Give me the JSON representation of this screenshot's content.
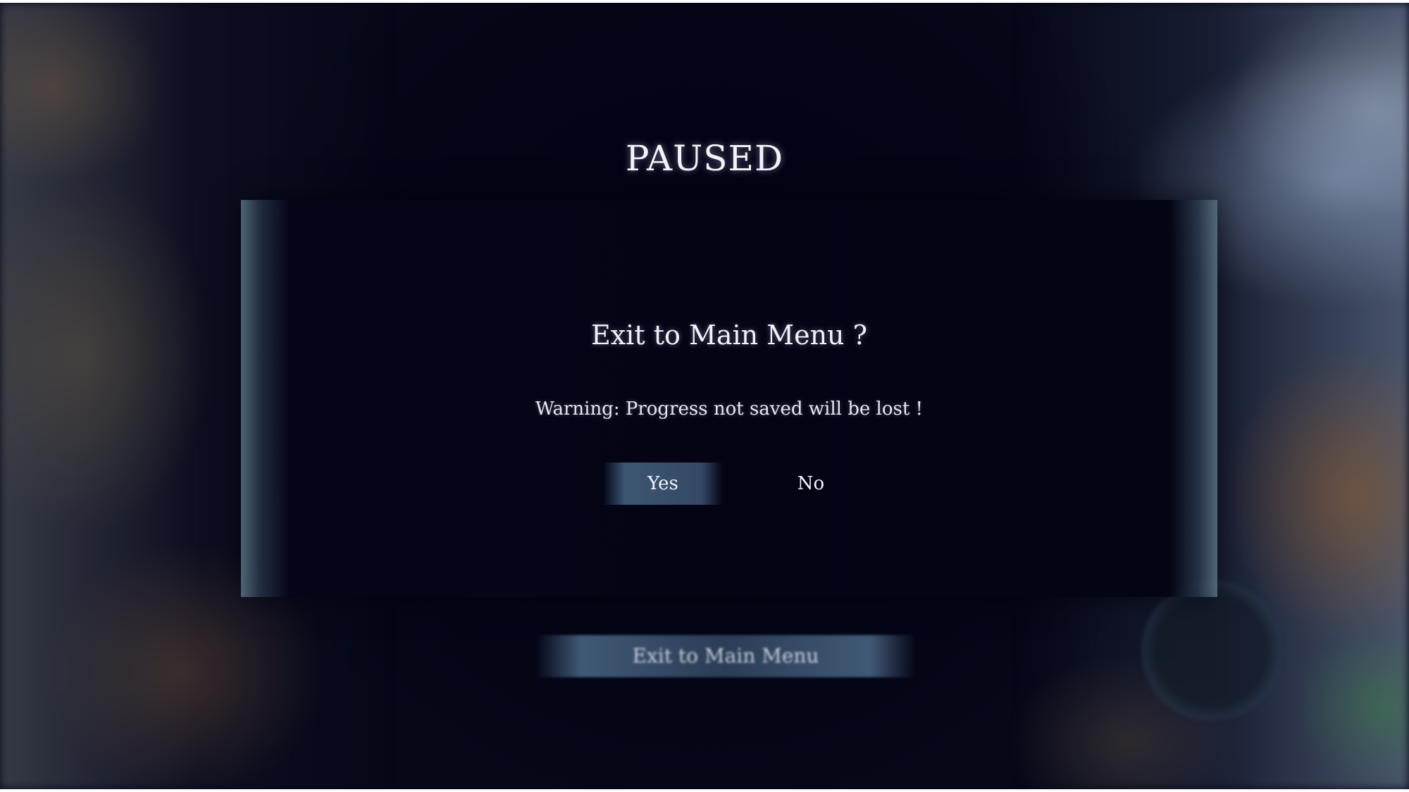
{
  "pause_menu": {
    "title": "PAUSED",
    "background_menu_item": "Exit to Main Menu"
  },
  "confirm_dialog": {
    "title": "Exit to Main Menu ?",
    "warning": "Warning: Progress not saved will be lost !",
    "yes_label": "Yes",
    "no_label": "No",
    "selected": "Yes"
  },
  "icons": {
    "corner_emblem": "round-emblem-icon"
  },
  "colors": {
    "background": "#060818",
    "dialog": "#03041a",
    "text": "#f3f4f8",
    "selected_button": "#46648a"
  }
}
